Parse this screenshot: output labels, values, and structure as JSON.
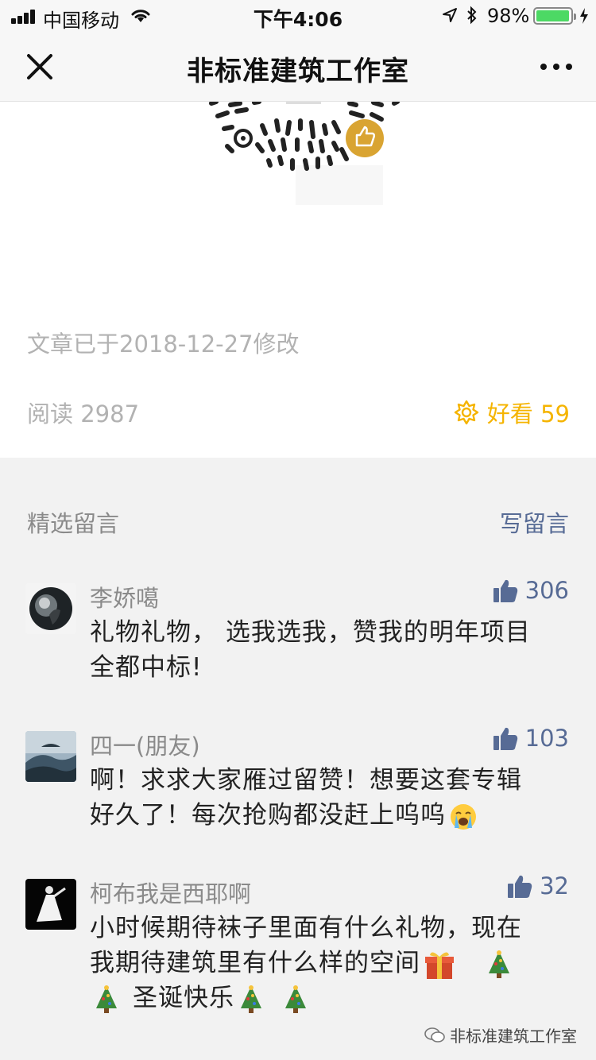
{
  "status_bar": {
    "carrier": "中国移动",
    "time": "下午4:06",
    "battery_percent": "98%",
    "battery_level": 0.98
  },
  "nav": {
    "title": "非标准建筑工作室",
    "close_icon": "close-icon",
    "more_icon": "more-icon"
  },
  "article": {
    "modified_note": "文章已于2018-12-27修改",
    "read_label": "阅读 2987",
    "good_label": "好看 59",
    "colors": {
      "good": "#f5b400",
      "link": "#576b95"
    }
  },
  "comments": {
    "header": "精选留言",
    "write_label": "写留言",
    "items": [
      {
        "name": "李娇噶",
        "likes": "306",
        "text_line1": "礼物礼物， 选我选我，赞我的明年项目",
        "text_line2": "全都中标!"
      },
      {
        "name": "四一(朋友)",
        "likes": "103",
        "text_line1": "啊！求求大家雁过留赞！想要这套专辑",
        "text_line2": "好久了！每次抢购都没赶上呜呜"
      },
      {
        "name": "柯布我是西耶啊",
        "likes": "32",
        "text_line1": "小时候期待袜子里面有什么礼物，现在",
        "text_line2": "我期待建筑里有什么样的空间",
        "text_line3": "圣诞快乐"
      }
    ]
  },
  "watermark": "非标准建筑工作室"
}
